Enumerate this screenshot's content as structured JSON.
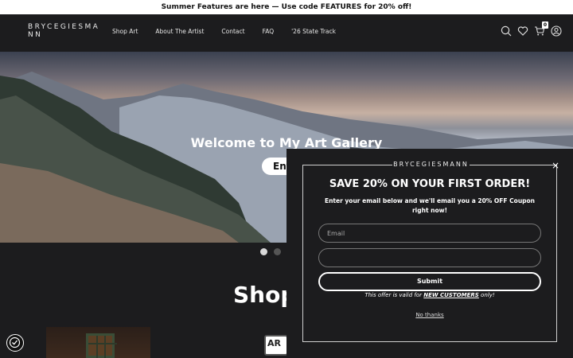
{
  "announcement": "Summer Features are here — Use code FEATURES for 20% off!",
  "header": {
    "logo": "BRYCEGIESMANN",
    "nav": [
      "Shop Art",
      "About The Artist",
      "Contact",
      "FAQ",
      "'26 State Track"
    ],
    "icons": [
      "search-icon",
      "heart-icon",
      "cart-icon",
      "account-icon"
    ],
    "cart_count": "0"
  },
  "hero": {
    "title": "Welcome to My Art Gallery",
    "button": "Ent",
    "slides": 2,
    "active_slide": 1
  },
  "section": {
    "title": "Shop"
  },
  "badge": {
    "text": "AR"
  },
  "popup": {
    "brand": "BRYCEGIESMANN",
    "close": "×",
    "heading": "SAVE 20% ON YOUR FIRST ORDER!",
    "subtext": "Enter your email below and we'll email you a 20% OFF Coupon right now!",
    "email_placeholder": "Email",
    "second_field_value": "",
    "submit": "Submit",
    "offer_prefix": "This offer is valid for ",
    "offer_emphasis": "NEW CUSTOMERS",
    "offer_suffix": " only!",
    "no_thanks": "No thanks"
  }
}
